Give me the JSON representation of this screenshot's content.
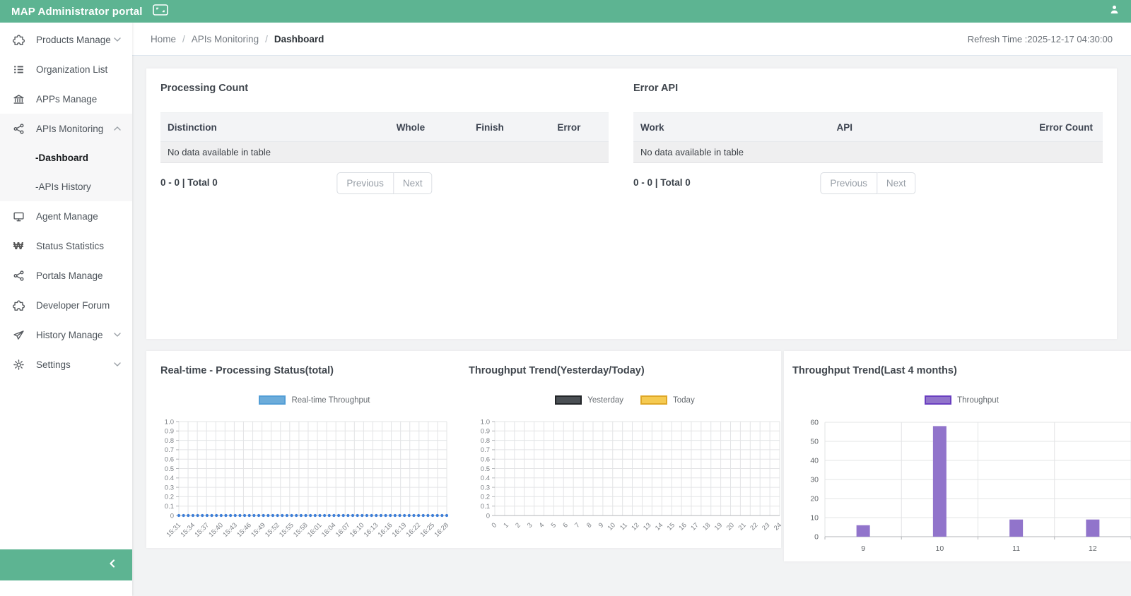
{
  "header": {
    "title": "MAP Administrator portal"
  },
  "refresh_time": "Refresh Time :2025-12-17 04:30:00",
  "breadcrumb": {
    "separator": "/",
    "items": [
      {
        "label": "Home",
        "current": false
      },
      {
        "label": "APIs Monitoring",
        "current": false
      },
      {
        "label": "Dashboard",
        "current": true
      }
    ]
  },
  "sidebar": {
    "items": [
      {
        "label": "Products Manage",
        "icon": "puzzle-icon",
        "chevron": "down"
      },
      {
        "label": "Organization List",
        "icon": "list-icon"
      },
      {
        "label": "APPs Manage",
        "icon": "bank-icon"
      },
      {
        "label": "APIs Monitoring",
        "icon": "share-icon",
        "chevron": "up",
        "active": true,
        "children": [
          {
            "label": "-Dashboard",
            "active": true
          },
          {
            "label": "-APIs History",
            "active": false
          }
        ]
      },
      {
        "label": "Agent Manage",
        "icon": "monitor-icon"
      },
      {
        "label": "Status Statistics",
        "icon": "won-icon"
      },
      {
        "label": "Portals Manage",
        "icon": "share-icon"
      },
      {
        "label": "Developer Forum",
        "icon": "puzzle-icon"
      },
      {
        "label": "History Manage",
        "icon": "paper-plane-icon",
        "chevron": "down"
      },
      {
        "label": "Settings",
        "icon": "gear-icon",
        "chevron": "down"
      }
    ]
  },
  "tables": {
    "processing": {
      "title": "Processing Count",
      "columns": [
        "Distinction",
        "Whole",
        "Finish",
        "Error"
      ],
      "empty_text": "No data available in table",
      "pagination": {
        "summary": "0 - 0 | Total 0",
        "prev": "Previous",
        "next": "Next"
      }
    },
    "error_api": {
      "title": "Error API",
      "columns": [
        "Work",
        "API",
        "Error Count"
      ],
      "empty_text": "No data available in table",
      "pagination": {
        "summary": "0 - 0 | Total 0",
        "prev": "Previous",
        "next": "Next"
      }
    }
  },
  "colors": {
    "header_green": "#5db492",
    "point_blue": "#3e7fd8",
    "bar_purple": "#9174cb"
  },
  "chart_data": [
    {
      "type": "scatter",
      "title": "Real-time - Processing Status(total)",
      "legend": [
        {
          "label": "Real-time Throughput",
          "fill": "#6cacda",
          "border": "#539ed6"
        }
      ],
      "legend_position": "top",
      "grid": true,
      "ylim": [
        0,
        1.0
      ],
      "y_ticks": [
        "1.0",
        "0.9",
        "0.8",
        "0.7",
        "0.6",
        "0.5",
        "0.4",
        "0.3",
        "0.2",
        "0.1",
        "0"
      ],
      "x_ticks": [
        "15:31",
        "15:34",
        "15:37",
        "15:40",
        "15:43",
        "15:46",
        "15:49",
        "15:52",
        "15:55",
        "15:58",
        "16:01",
        "16:04",
        "16:07",
        "16:10",
        "16:13",
        "16:16",
        "16:19",
        "16:22",
        "16:25",
        "16:28"
      ],
      "num_points": 58,
      "point_value": 0,
      "point_color": "#3e7fd8"
    },
    {
      "type": "line",
      "title": "Throughput Trend(Yesterday/Today)",
      "legend": [
        {
          "label": "Yesterday",
          "fill": "#4a4f54",
          "border": "#232629"
        },
        {
          "label": "Today",
          "fill": "#f5ca51",
          "border": "#dfa827"
        }
      ],
      "legend_position": "top",
      "grid": true,
      "ylim": [
        0,
        1.0
      ],
      "y_ticks": [
        "1.0",
        "0.9",
        "0.8",
        "0.7",
        "0.6",
        "0.5",
        "0.4",
        "0.3",
        "0.2",
        "0.1",
        "0"
      ],
      "x_ticks": [
        "0",
        "1",
        "2",
        "3",
        "4",
        "5",
        "6",
        "7",
        "8",
        "9",
        "10",
        "11",
        "12",
        "13",
        "14",
        "15",
        "16",
        "17",
        "18",
        "19",
        "20",
        "21",
        "22",
        "23",
        "24"
      ],
      "series": [
        {
          "name": "Yesterday",
          "values": []
        },
        {
          "name": "Today",
          "values": []
        }
      ]
    },
    {
      "type": "bar",
      "title": "Throughput Trend(Last 4 months)",
      "legend": [
        {
          "label": "Throughput",
          "fill": "#9174cb",
          "border": "#6a3fc0"
        }
      ],
      "legend_position": "top",
      "grid": true,
      "categories": [
        "9",
        "10",
        "11",
        "12"
      ],
      "values": [
        6,
        58,
        9,
        9
      ],
      "ylim": [
        0,
        60
      ],
      "y_ticks": [
        "60",
        "50",
        "40",
        "30",
        "20",
        "10",
        "0"
      ],
      "bar_color": "#9174cb"
    }
  ]
}
